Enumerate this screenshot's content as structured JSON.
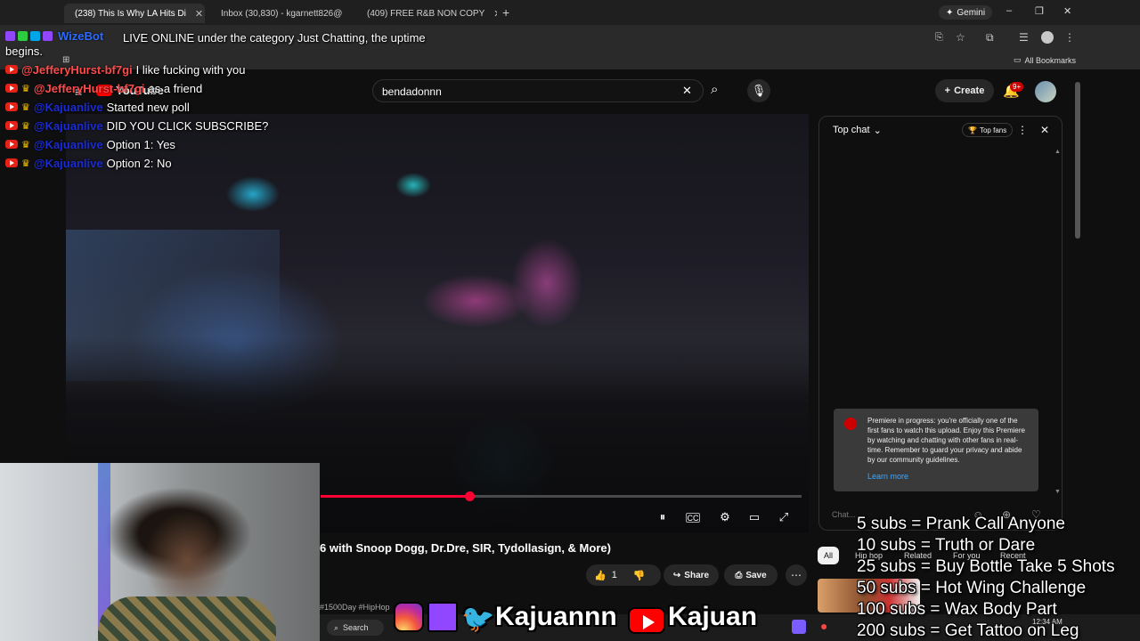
{
  "browser": {
    "tabs": [
      {
        "title": "(238) This Is Why LA Hits Di",
        "favicon_color": "#ff0000",
        "active": true
      },
      {
        "title": "Inbox (30,830) - kgarnett826@",
        "favicon_color": "#ea4335",
        "active": false
      },
      {
        "title": "(409) FREE R&B NON COPY",
        "favicon_color": "#ff0000",
        "active": false
      }
    ],
    "new_tab": "+",
    "gemini_label": "Gemini",
    "window_controls": {
      "minimize": "–",
      "restore": "❐",
      "close": "✕"
    },
    "bookmarks_label": "All Bookmarks"
  },
  "overlay_chat": {
    "bot_name": "WizeBot",
    "bot_message": "LIVE ONLINE under the category Just Chatting, the uptime",
    "bot_message_cont": "begins.",
    "lines": [
      {
        "user": "@JefferyHurst-bf7gi",
        "user_color": "#ff4b4b",
        "message": "I like fucking with you",
        "crown": false
      },
      {
        "user": "@JefferyHurst-bf7gi",
        "user_color": "#ff4b4b",
        "message": "as a friend",
        "crown": true
      },
      {
        "user": "@Kajuanlive",
        "user_color": "#1b2bd6",
        "message": "Started new poll",
        "crown": true
      },
      {
        "user": "@Kajuanlive",
        "user_color": "#1b2bd6",
        "message": "DID YOU CLICK SUBSCRIBE?",
        "crown": true
      },
      {
        "user": "@Kajuanlive",
        "user_color": "#1b2bd6",
        "message": "Option 1: Yes",
        "crown": true
      },
      {
        "user": "@Kajuanlive",
        "user_color": "#1b2bd6",
        "message": "Option 2: No",
        "crown": true
      }
    ]
  },
  "youtube": {
    "logo_text": "YouTube",
    "search_value": "bendadonnn",
    "create_label": "Create",
    "notification_count": "9+",
    "video_title": "6 with Snoop Dogg, Dr.Dre, SIR, Tydollasign, & More)",
    "like_count": "1",
    "share_label": "Share",
    "save_label": "Save",
    "hashtags": "#1500Day #HipHop",
    "progress_fraction": 0.31
  },
  "live_chat": {
    "header": "Top chat",
    "top_fans_label": "Top fans",
    "premiere_text": "Premiere in progress: you're officially one of the first fans to watch this upload. Enjoy this Premiere by watching and chatting with other fans in real-time. Remember to guard your privacy and abide by our community guidelines.",
    "learn_more": "Learn more",
    "chat_placeholder": "Chat..."
  },
  "filter_chips": [
    "All",
    "Hip hop",
    "Related",
    "For you",
    "Recent"
  ],
  "sub_goals": [
    "5 subs =  Prank Call Anyone",
    "10 subs = Truth or Dare",
    "25 subs = Buy Bottle Take 5 Shots",
    "50 subs = Hot Wing Challenge",
    "100 subs = Wax Body Part",
    "200 subs = Get Tattoo on Leg"
  ],
  "social": {
    "name_1": "Kajuannn",
    "name_2": "Kajuan"
  },
  "taskbar": {
    "search_label": "Search",
    "clock_time": "12:34 AM"
  }
}
